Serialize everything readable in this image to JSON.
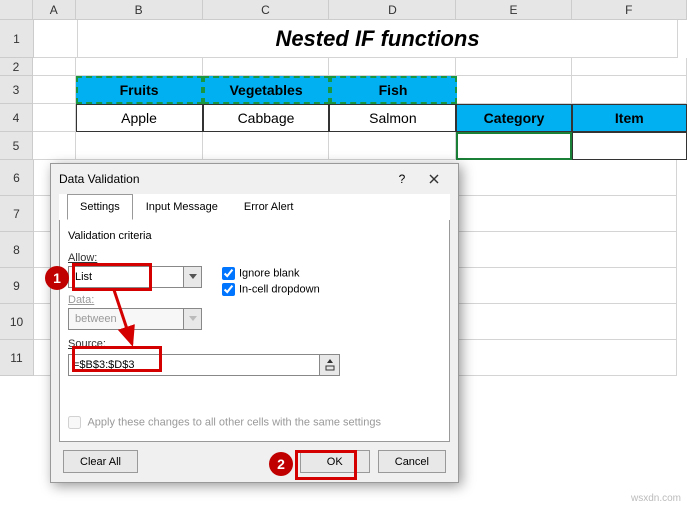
{
  "columns": [
    "A",
    "B",
    "C",
    "D",
    "E",
    "F"
  ],
  "rows": [
    "1",
    "2",
    "3",
    "4",
    "5",
    "6",
    "7",
    "8",
    "9",
    "10",
    "11"
  ],
  "title": "Nested IF functions",
  "table": {
    "headers": [
      "Fruits",
      "Vegetables",
      "Fish"
    ],
    "data": [
      "Apple",
      "Cabbage",
      "Salmon"
    ],
    "cat_label": "Category",
    "item_label": "Item"
  },
  "dialog": {
    "title": "Data Validation",
    "help": "?",
    "tabs": {
      "settings": "Settings",
      "input_msg": "Input Message",
      "error_alert": "Error Alert"
    },
    "criteria_label": "Validation criteria",
    "allow_label": "Allow:",
    "allow_value": "List",
    "data_label": "Data:",
    "data_value": "between",
    "source_label": "Source:",
    "source_value": "=$B$3:$D$3",
    "ignore_blank": "Ignore blank",
    "incell_dd": "In-cell dropdown",
    "apply_all": "Apply these changes to all other cells with the same settings",
    "clear": "Clear All",
    "ok": "OK",
    "cancel": "Cancel"
  },
  "annotations": {
    "badge1": "1",
    "badge2": "2"
  },
  "watermark": "wsxdn.com"
}
